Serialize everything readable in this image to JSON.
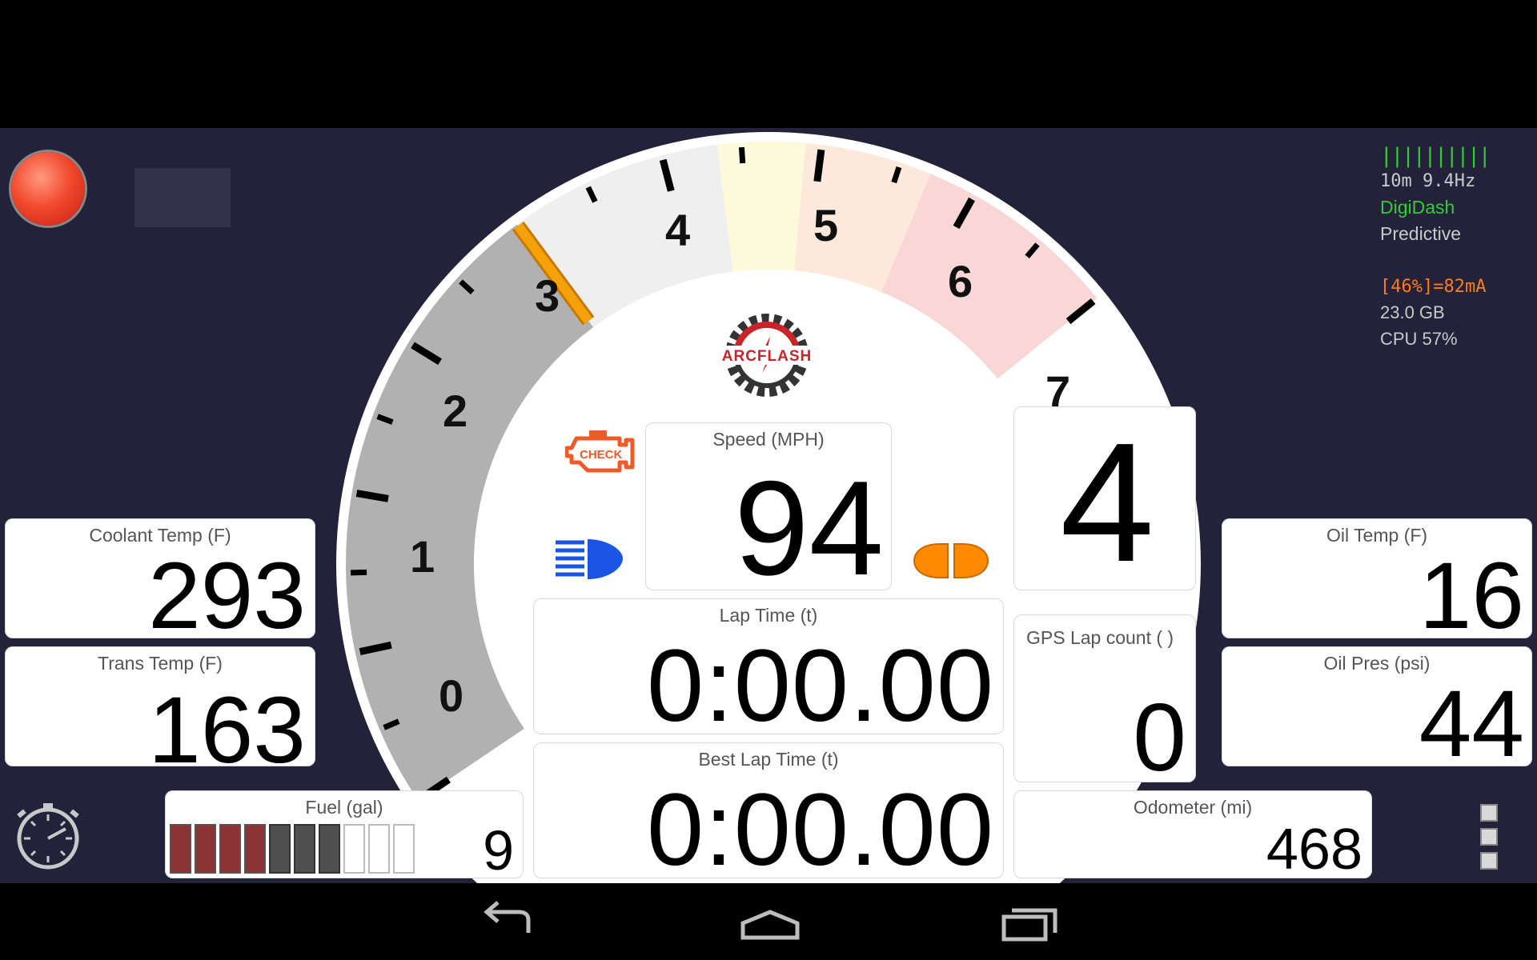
{
  "gauge": {
    "type": "tachometer",
    "max_value": 8,
    "value": 4,
    "labels": [
      "0",
      "1",
      "2",
      "3",
      "4",
      "5",
      "6",
      "7"
    ],
    "colors": {
      "filled": "#b1b1b1",
      "needle": "#f5a10a",
      "face": "#efefef",
      "caution": "#fcfadb",
      "warn": "#fde8dc",
      "red": "#fad7d7",
      "bezel": "#ffffff"
    }
  },
  "logo": {
    "text": "ARCFLASH"
  },
  "indicators": {
    "check_engine": "CHECK"
  },
  "gauges": {
    "speed": {
      "label": "Speed (MPH)",
      "value": "94"
    },
    "gear": {
      "value": "4"
    },
    "lap_time": {
      "label": "Lap Time (t)",
      "value": "0:00.00"
    },
    "best_lap_time": {
      "label": "Best Lap Time (t)",
      "value": "0:00.00"
    },
    "gps_lap_count": {
      "label": "GPS Lap count ( )",
      "value": "0"
    },
    "coolant_temp": {
      "label": "Coolant Temp (F)",
      "value": "293"
    },
    "trans_temp": {
      "label": "Trans Temp (F)",
      "value": "163"
    },
    "oil_temp": {
      "label": "Oil Temp (F)",
      "value": "16"
    },
    "oil_pres": {
      "label": "Oil Pres (psi)",
      "value": "44"
    },
    "fuel": {
      "label": "Fuel (gal)",
      "value": "9",
      "bars_total": 10,
      "bars_red": 4,
      "bars_grey": 3
    },
    "odometer": {
      "label": "Odometer (mi)",
      "value": "468"
    }
  },
  "status": {
    "signal_bars": "||||||||||",
    "timer_rate": "10m  9.4Hz",
    "app_name": "DigiDash",
    "mode": "Predictive",
    "battery": "[46%]=82mA",
    "storage": "23.0 GB",
    "cpu": "CPU  57%"
  },
  "colors": {
    "background": "#23223a",
    "status_green": "#2fcf2f",
    "status_orange": "#ff7a1a",
    "indicator_blue": "#1a55e6",
    "indicator_orange": "#ff8a00"
  },
  "icons": {
    "record": "record-button-icon",
    "stopwatch": "stopwatch-icon",
    "menu": "overflow-menu-icon",
    "back": "back-icon",
    "home": "home-icon",
    "recents": "recents-icon"
  }
}
